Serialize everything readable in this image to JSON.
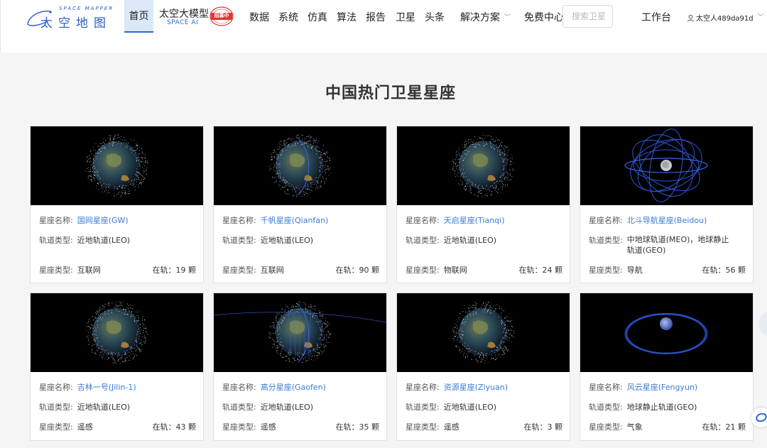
{
  "header": {
    "logo_top": "SPACE MAPPER",
    "logo_main": "太空地图",
    "nav_home": "首页",
    "ai_title": "太空大模型",
    "ai_sub": "SPACE AI",
    "ai_stamp": "招募中",
    "nav": [
      "数据",
      "系统",
      "仿真",
      "算法",
      "报告",
      "卫星",
      "头条"
    ],
    "solutions": "解决方案",
    "free_center": "免费中心",
    "search_placeholder": "搜索卫星",
    "workbench": "工作台",
    "user": "太空人489da91d"
  },
  "section": {
    "title": "中国热门卫星星座"
  },
  "labels": {
    "name": "星座名称:",
    "orbit": "轨道类型:",
    "type": "星座类型:",
    "count_prefix": "在轨："
  },
  "cards": [
    {
      "name": "国网星座(GW)",
      "orbit": "近地轨道(LEO)",
      "type": "互联网",
      "count": "19 颗",
      "image": "earth-leo-constellation"
    },
    {
      "name": "千帆星座(Qianfan)",
      "orbit": "近地轨道(LEO)",
      "type": "互联网",
      "count": "90 颗",
      "image": "earth-leo-constellation"
    },
    {
      "name": "天启星座(Tianqi)",
      "orbit": "近地轨道(LEO)",
      "type": "物联网",
      "count": "24 颗",
      "image": "earth-leo-constellation"
    },
    {
      "name": "北斗导航星座(Beidou)",
      "orbit": "中地球轨道(MEO)，地球静止轨道(GEO)",
      "type": "导航",
      "count": "56 颗",
      "image": "earth-meo-orbits"
    },
    {
      "name": "吉林一号(Jilin-1)",
      "orbit": "近地轨道(LEO)",
      "type": "遥感",
      "count": "43 颗",
      "image": "earth-leo-constellation"
    },
    {
      "name": "高分星座(Gaofen)",
      "orbit": "近地轨道(LEO)",
      "type": "遥感",
      "count": "35 颗",
      "image": "earth-leo-constellation"
    },
    {
      "name": "资源星座(Ziyuan)",
      "orbit": "近地轨道(LEO)",
      "type": "遥感",
      "count": "3 颗",
      "image": "earth-leo-constellation"
    },
    {
      "name": "风云星座(Fengyun)",
      "orbit": "地球静止轨道(GEO)",
      "type": "气象",
      "count": "21 颗",
      "image": "earth-geo-ring"
    }
  ],
  "colors": {
    "accent": "#3a7bd5",
    "nav_active_bg": "#dbe8f9",
    "page_bg": "#f5f5f5"
  }
}
